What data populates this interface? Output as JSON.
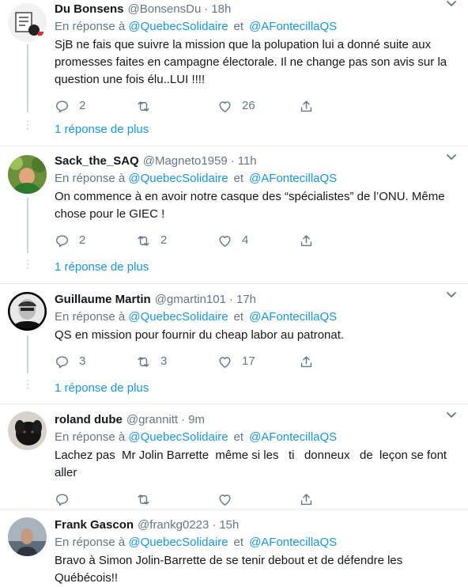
{
  "reply_prefix": "En réponse à",
  "and_word": "et",
  "tweets": [
    {
      "name": "Du Bonsens",
      "handle": "@BonsensDu",
      "time": "18h",
      "mentions": [
        "@QuebecSolidaire",
        "@AFontecillaQS"
      ],
      "text": "SjB ne fais que suivre la mission que la polupation lui a donné suite aux promesses faites en campagne électorale. Il ne change pas son avis sur la question une fois élu..LUI !!!!",
      "replies": "2",
      "retweets": "",
      "likes": "26",
      "more": "1 réponse de plus"
    },
    {
      "name": "Sack_the_SAQ",
      "handle": "@Magneto1959",
      "time": "11h",
      "mentions": [
        "@QuebecSolidaire",
        "@AFontecillaQS"
      ],
      "text": "On commence à en avoir notre casque des “spécialistes” de l’ONU. Même chose pour le GIEC !",
      "replies": "2",
      "retweets": "2",
      "likes": "4",
      "more": "1 réponse de plus"
    },
    {
      "name": "Guillaume Martin",
      "handle": "@gmartin101",
      "time": "17h",
      "mentions": [
        "@QuebecSolidaire",
        "@AFontecillaQS"
      ],
      "text": "QS en mission pour fournir du cheap labor au patronat.",
      "replies": "3",
      "retweets": "3",
      "likes": "17",
      "more": "1 réponse de plus"
    },
    {
      "name": "roland dube",
      "handle": "@grannitt",
      "time": "9m",
      "mentions": [
        "@QuebecSolidaire",
        "@AFontecillaQS"
      ],
      "text": "Lachez pas  Mr Jolin Barrette  même si les   ti   donneux   de  leçon se font aller",
      "replies": "",
      "retweets": "",
      "likes": "",
      "more": ""
    },
    {
      "name": "Frank Gascon",
      "handle": "@frankg0223",
      "time": "15h",
      "mentions": [
        "@QuebecSolidaire",
        "@AFontecillaQS"
      ],
      "text": "Bravo à Simon Jolin-Barrette de se tenir debout et de défendre les Québécois!!",
      "replies": "",
      "retweets": "",
      "likes": "",
      "more": ""
    }
  ]
}
